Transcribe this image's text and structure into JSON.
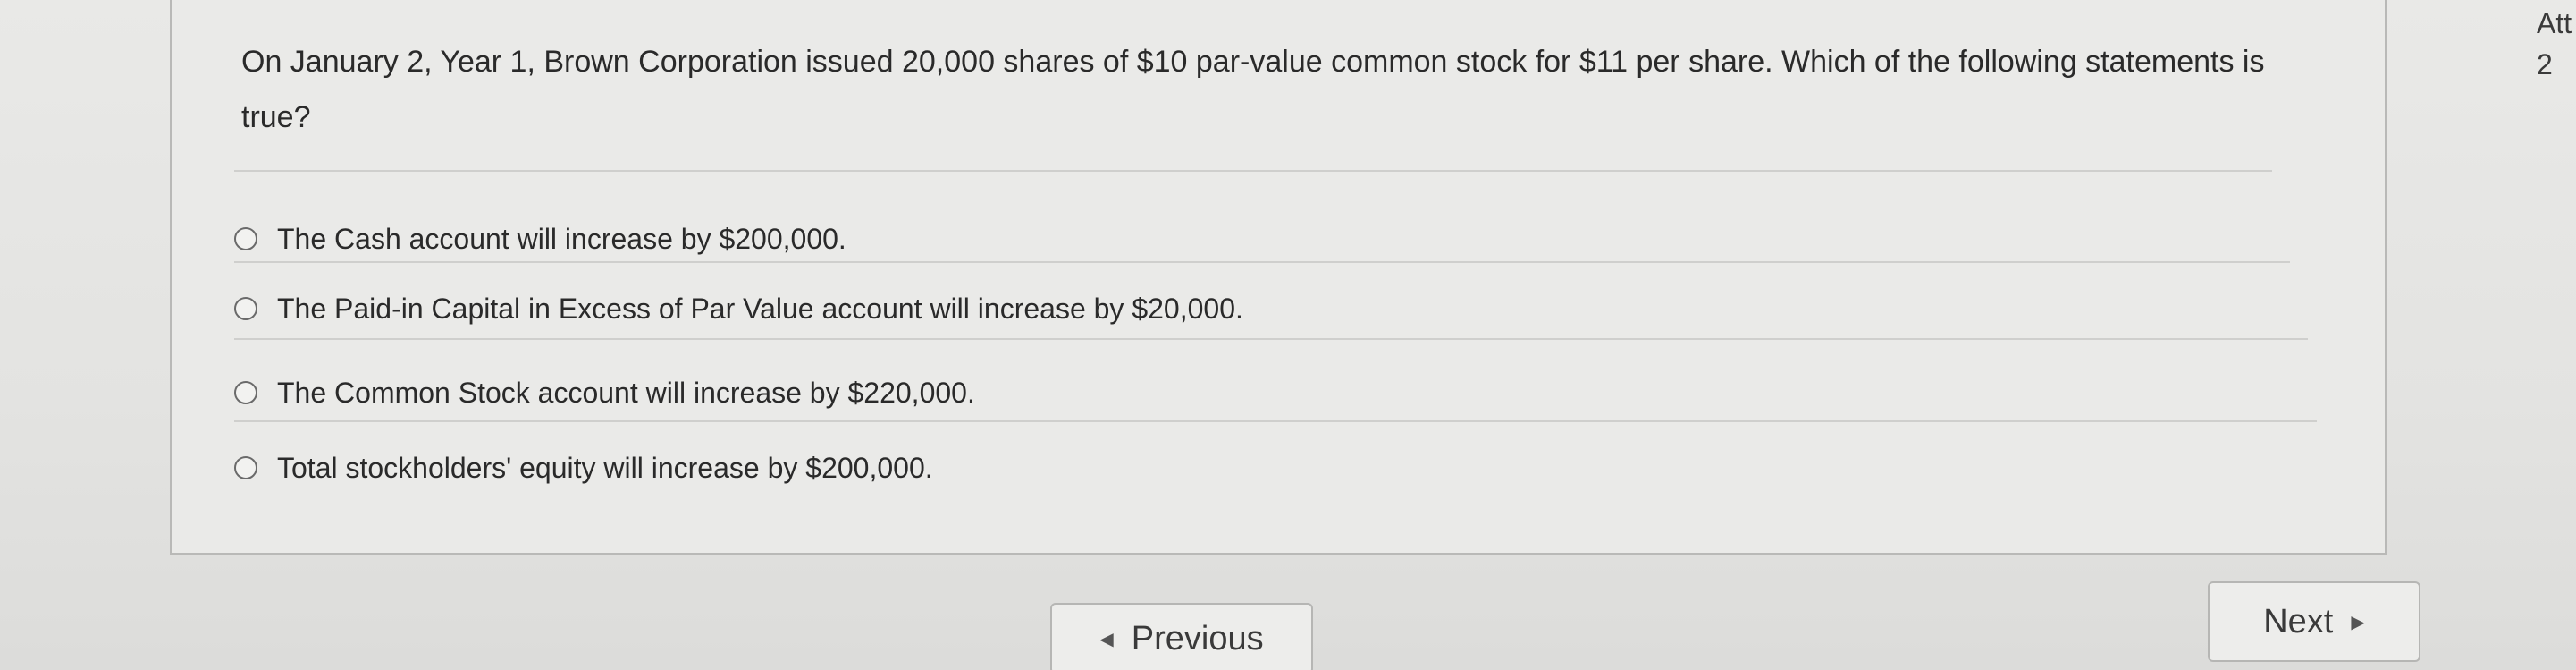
{
  "question": {
    "text": "On January 2, Year 1, Brown Corporation issued 20,000 shares of $10 par-value common stock for $11 per share. Which of the following statements is true?",
    "options": [
      {
        "label": "The Cash account will increase by $200,000.",
        "selected": false
      },
      {
        "label": "The Paid-in Capital in Excess of Par Value account will increase by $20,000.",
        "selected": false
      },
      {
        "label": "The Common Stock account will increase by $220,000.",
        "selected": false
      },
      {
        "label": "Total stockholders' equity will increase by $200,000.",
        "selected": false
      }
    ]
  },
  "navigation": {
    "previous_label": "Previous",
    "next_label": "Next",
    "previous_icon": "triangle-left-icon",
    "next_icon": "triangle-right-icon"
  },
  "side_panel": {
    "line1": "Att",
    "line2": "2"
  }
}
